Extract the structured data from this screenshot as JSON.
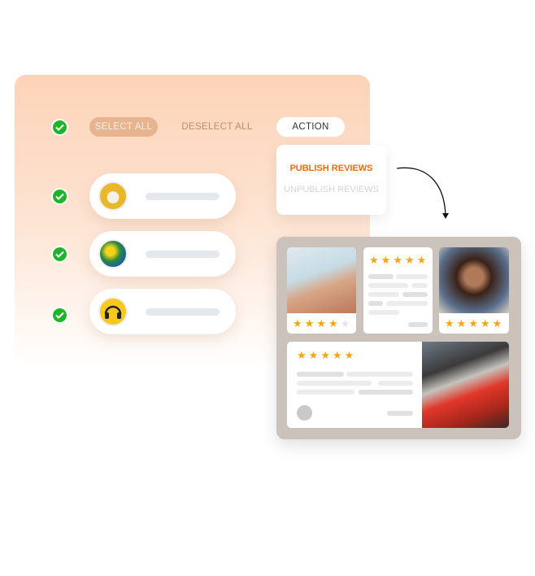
{
  "toolbar": {
    "select_all": "SELECT ALL",
    "deselect_all": "DESELECT ALL",
    "action": "ACTION"
  },
  "dropdown": {
    "items": [
      {
        "label": "PUBLISH REVIEWS",
        "active": true
      },
      {
        "label": "UNPUBLISH REVIEWS",
        "active": false
      }
    ]
  },
  "colors": {
    "accent": "#f26b0a",
    "check": "#1fb52a",
    "star": "#f6a516"
  },
  "products": [
    {
      "icon": "airpods-thumbnail",
      "selected": true
    },
    {
      "icon": "globe-thumbnail",
      "selected": true
    },
    {
      "icon": "headphones-thumbnail",
      "selected": true
    }
  ],
  "reviews": [
    {
      "rating": 4,
      "photo": "woman-headphones-beach"
    },
    {
      "rating": 5,
      "photo": null
    },
    {
      "rating": 5,
      "photo": "woman-headphones-curly"
    },
    {
      "rating": 5,
      "photo": "sneakers-red-step"
    }
  ]
}
